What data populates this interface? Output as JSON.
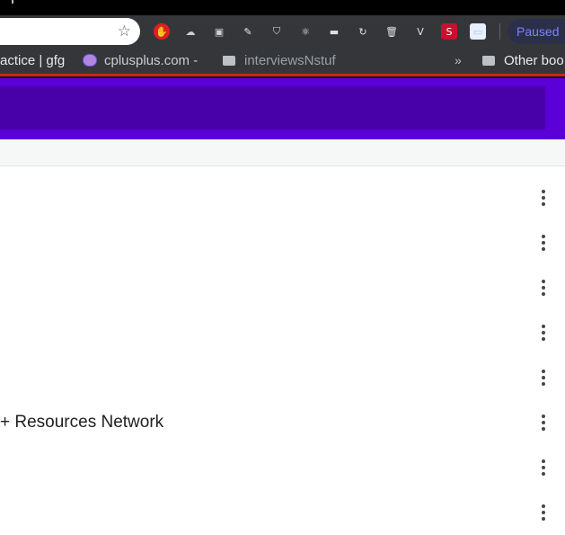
{
  "browser": {
    "omnibox": {
      "star_icon": "bookmark-star-icon"
    },
    "extensions": [
      {
        "name": "adblock-icon",
        "glyph": "✋",
        "color": "#e02020"
      },
      {
        "name": "cloud-extension-icon",
        "glyph": "☁",
        "color": "#cfcfcf"
      },
      {
        "name": "tab-manager-icon",
        "glyph": "▣",
        "color": "#cfcfcf"
      },
      {
        "name": "dropper-icon",
        "glyph": "✎",
        "color": "#e8e8e8"
      },
      {
        "name": "shield-icon",
        "glyph": "⛉",
        "color": "#d8d8d8"
      },
      {
        "name": "react-devtools-icon",
        "glyph": "⚛",
        "color": "#e8e8e8"
      },
      {
        "name": "screen-capture-icon",
        "glyph": "▬",
        "color": "#e0e0e0"
      },
      {
        "name": "refresh-extension-icon",
        "glyph": "↻",
        "color": "#e0e0e0"
      },
      {
        "name": "trash-icon",
        "glyph": "🗑",
        "color": "#e0e0e0"
      },
      {
        "name": "vue-devtools-icon",
        "glyph": "V",
        "color": "#e0e0e0"
      },
      {
        "name": "s-extension-icon",
        "glyph": "S",
        "color": "#ffffff",
        "bg": "#c8102e"
      },
      {
        "name": "screenshot-extension-icon",
        "glyph": "▭",
        "color": "#9ec6ff",
        "bg": "#e8f0ff"
      }
    ],
    "profile_status": "Paused",
    "bookmarks": [
      {
        "label": "actice | gfg",
        "type": "link"
      },
      {
        "label": "cplusplus.com -",
        "type": "link",
        "icon": "cplusplus-favicon-icon"
      },
      {
        "label": "interviewsNstuf",
        "type": "folder"
      }
    ],
    "overflow_chevron": "»",
    "other_bookmarks": "Other boo"
  },
  "colors": {
    "header_purple": "#5b00d8",
    "header_inner": "#4800a8",
    "accent_red": "#c8261b"
  },
  "list": {
    "rows": [
      {
        "title": ""
      },
      {
        "title": ""
      },
      {
        "title": ""
      },
      {
        "title": ""
      },
      {
        "title": ""
      },
      {
        "title": "+ Resources Network"
      },
      {
        "title": ""
      },
      {
        "title": ""
      }
    ]
  }
}
